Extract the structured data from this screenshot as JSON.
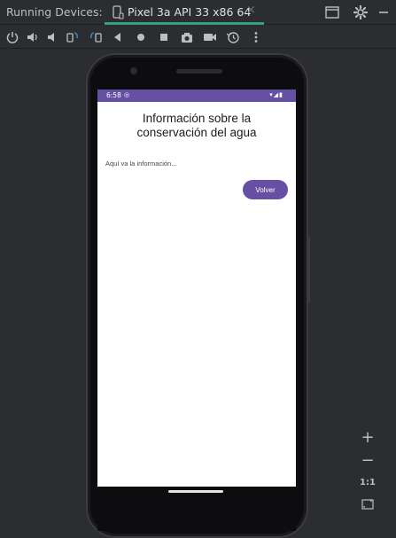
{
  "window": {
    "title": "Running Devices:",
    "tab_label": "Pixel 3a API 33 x86 64",
    "tab_close": "×"
  },
  "toolbar": {
    "icons": [
      "power-icon",
      "volume-up-icon",
      "volume-down-icon",
      "rotate-left-icon",
      "rotate-right-icon",
      "back-icon",
      "home-icon",
      "overview-icon",
      "screenshot-icon",
      "screen-record-icon",
      "snapshot-icon",
      "more-icon"
    ]
  },
  "device": {
    "status_time": "6:58",
    "status_right": "▾◢▮",
    "app": {
      "title": "Información sobre la conservación del agua",
      "info_text": "Aquí va la información...",
      "button_label": "Volver"
    }
  },
  "zoom": {
    "plus": "+",
    "minus": "−",
    "one_to_one": "1:1"
  },
  "colors": {
    "ide_bg": "#2b2d30",
    "status_bar": "#6650a4",
    "primary": "#6750a4",
    "tab_underline": "#2fa37b"
  }
}
